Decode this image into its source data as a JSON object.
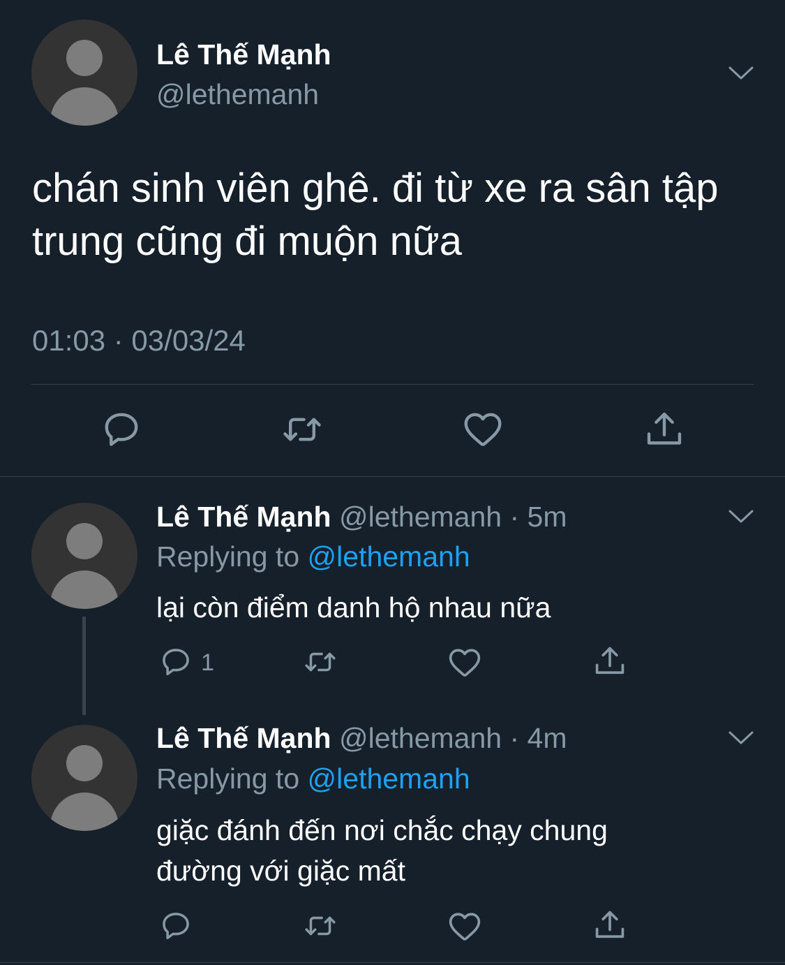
{
  "main_tweet": {
    "name": "Lê Thế Mạnh",
    "handle": "@lethemanh",
    "text": "chán sinh viên ghê. đi từ xe ra sân tập trung cũng đi muộn nữa",
    "meta": "01:03 · 03/03/24"
  },
  "replies": [
    {
      "name": "Lê Thế Mạnh",
      "handle": "@lethemanh",
      "time": "5m",
      "replying_label": "Replying to",
      "replying_handle": "@lethemanh",
      "text": "lại còn điểm danh hộ nhau nữa",
      "reply_count": "1"
    },
    {
      "name": "Lê Thế Mạnh",
      "handle": "@lethemanh",
      "time": "4m",
      "replying_label": "Replying to",
      "replying_handle": "@lethemanh",
      "text": "giặc đánh đến nơi chắc chạy chung đường với giặc mất",
      "reply_count": ""
    }
  ],
  "icons": {
    "reply": "reply-icon",
    "retweet": "retweet-icon",
    "like": "heart-icon",
    "share": "share-icon",
    "more": "chevron-down-icon",
    "avatar": "default-avatar-icon"
  },
  "colors": {
    "background": "#15202b",
    "primary_text": "#ffffff",
    "secondary_text": "#8899a6",
    "mention": "#1da1f2",
    "divider": "#38444d"
  }
}
